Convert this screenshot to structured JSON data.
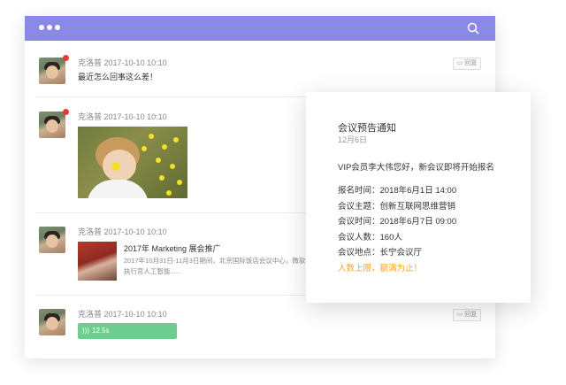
{
  "messages": [
    {
      "author": "克洛普",
      "time": "2017-10-10 10:10",
      "text": "最近怎么回事这么差！",
      "reply_label": "回复"
    },
    {
      "author": "克洛普",
      "time": "2017-10-10 10:10"
    },
    {
      "author": "克洛普",
      "time": "2017-10-10 10:10",
      "card_title": "2017年 Marketing 展会推广",
      "card_desc": "2017年10月31日-11月3日期间，北京国际饭店会议中心，微软公司首席执行官人工智能......"
    },
    {
      "author": "克洛普",
      "time": "2017-10-10 10:10",
      "voice_duration": "12.5s",
      "reply_label": "回复"
    }
  ],
  "notice": {
    "title": "会议预告通知",
    "date": "12月6日",
    "greeting": "VIP会员李大伟您好，新会议即将开始报名",
    "lines": [
      "报名时间：2018年6月1日 14:00",
      "会议主题：创新互联网思维营销",
      "会议时间：2018年6月7日 09:00",
      "会议人数：160人",
      "会议地点：长宁会议厅"
    ],
    "warning": "人数上限，额满为止！"
  },
  "colors": {
    "topbar": "#8a8ae6",
    "voice": "#6ccf8f",
    "warning": "#f5a623",
    "unread": "#f0392e"
  },
  "icons": {
    "menu": "dots-icon",
    "search": "search-icon",
    "reply": "reply-icon",
    "voice": "voice-wave-icon"
  }
}
